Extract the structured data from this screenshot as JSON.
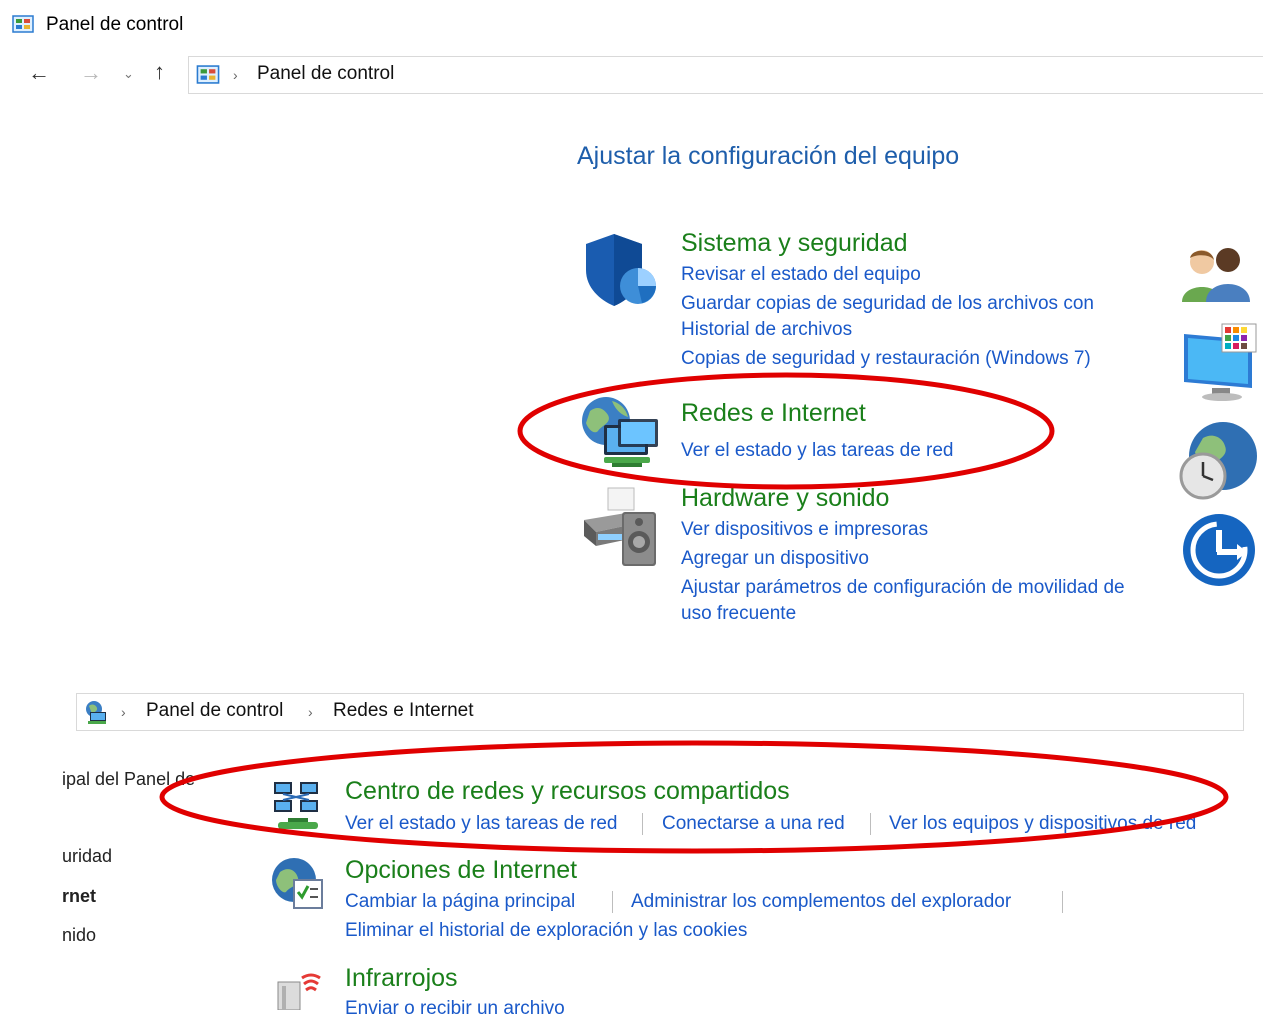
{
  "window": {
    "title": "Panel de control"
  },
  "top_address": {
    "crumbs": [
      "Panel de control"
    ]
  },
  "main": {
    "heading": "Ajustar la configuración del equipo",
    "categories": [
      {
        "title": "Sistema y seguridad",
        "links": [
          "Revisar el estado del equipo",
          "Guardar copias de seguridad de los archivos con",
          "Historial de archivos",
          "Copias de seguridad y restauración (Windows 7)"
        ]
      },
      {
        "title": "Redes e Internet",
        "links": [
          "Ver el estado y las tareas de red"
        ]
      },
      {
        "title": "Hardware y sonido",
        "links": [
          "Ver dispositivos e impresoras",
          "Agregar un dispositivo",
          "Ajustar parámetros de configuración de movilidad de",
          "uso frecuente"
        ]
      }
    ]
  },
  "second_address": {
    "crumbs": [
      "Panel de control",
      "Redes e Internet"
    ]
  },
  "sidebar": {
    "items": [
      "ipal del Panel de",
      "uridad",
      "rnet",
      "nido"
    ]
  },
  "sub": {
    "items": [
      {
        "title": "Centro de redes y recursos compartidos",
        "links": [
          "Ver el estado y las tareas de red",
          "Conectarse a una red",
          "Ver los equipos y dispositivos de red"
        ]
      },
      {
        "title": "Opciones de Internet",
        "links": [
          "Cambiar la página principal",
          "Administrar los complementos del explorador",
          "Eliminar el historial de exploración y las cookies"
        ]
      },
      {
        "title": "Infrarrojos",
        "links": [
          "Enviar o recibir un archivo"
        ]
      }
    ]
  },
  "colors": {
    "heading": "#1e5eab",
    "category_title": "#1a7f1a",
    "link": "#1a59c9",
    "annotation": "#e00000"
  },
  "icons": [
    "control-panel-icon",
    "back-arrow-icon",
    "forward-arrow-icon",
    "recent-dropdown-icon",
    "up-arrow-icon",
    "shield-icon",
    "network-globe-icon",
    "printer-icon",
    "users-icon",
    "display-icon",
    "clock-globe-icon",
    "ease-of-access-icon",
    "network-center-icon",
    "internet-options-icon",
    "infrared-icon"
  ]
}
